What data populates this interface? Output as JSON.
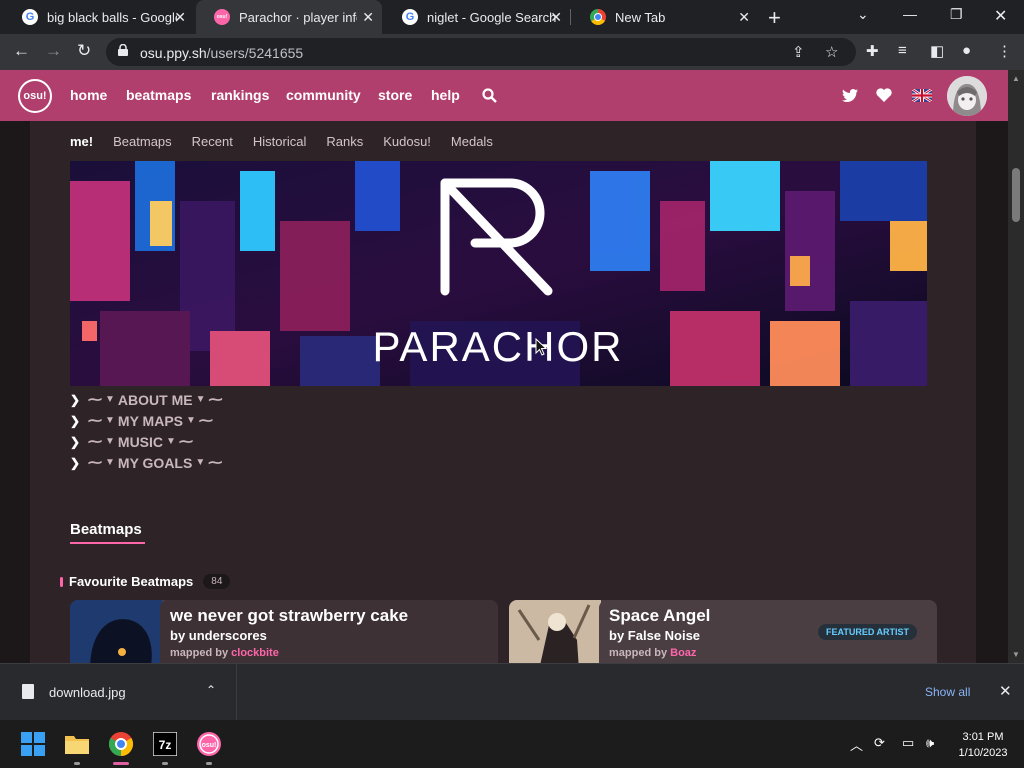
{
  "browser": {
    "tabs": [
      {
        "title": "big black balls - Google",
        "favicon": "google-icon"
      },
      {
        "title": "Parachor · player info |",
        "favicon": "osu-icon",
        "active": true
      },
      {
        "title": "niglet - Google Search",
        "favicon": "google-icon"
      },
      {
        "title": "New Tab",
        "favicon": "chrome-icon"
      }
    ],
    "url_host": "osu.ppy.sh",
    "url_path": "/users/5241655"
  },
  "osu_nav": {
    "logo": "osu!",
    "links": [
      "home",
      "beatmaps",
      "rankings",
      "community",
      "store",
      "help"
    ]
  },
  "profile_tabs": [
    "me!",
    "Beatmaps",
    "Recent",
    "Historical",
    "Ranks",
    "Kudosu!",
    "Medals"
  ],
  "banner": {
    "text": "PARACHOR"
  },
  "collapsibles": [
    "ABOUT ME",
    "MY MAPS",
    "MUSIC",
    "MY GOALS"
  ],
  "beatmaps_section": {
    "title": "Beatmaps",
    "favourites_label": "Favourite Beatmaps",
    "favourites_count": "84",
    "cards": [
      {
        "title": "we never got strawberry cake",
        "artist": "by underscores",
        "mapped_by": "mapped by",
        "mapper": "clockbite",
        "badge": ""
      },
      {
        "title": "Space Angel",
        "artist": "by False Noise",
        "mapped_by": "mapped by",
        "mapper": "Boaz",
        "badge": "FEATURED ARTIST"
      }
    ]
  },
  "downloads": {
    "file": "download.jpg",
    "show_all": "Show all"
  },
  "taskbar": {
    "time": "3:01 PM",
    "date": "1/10/2023"
  },
  "colors": {
    "osu_pink": "#ff66aa",
    "nav_bg": "#b13f6d",
    "panel": "#2e2428"
  }
}
